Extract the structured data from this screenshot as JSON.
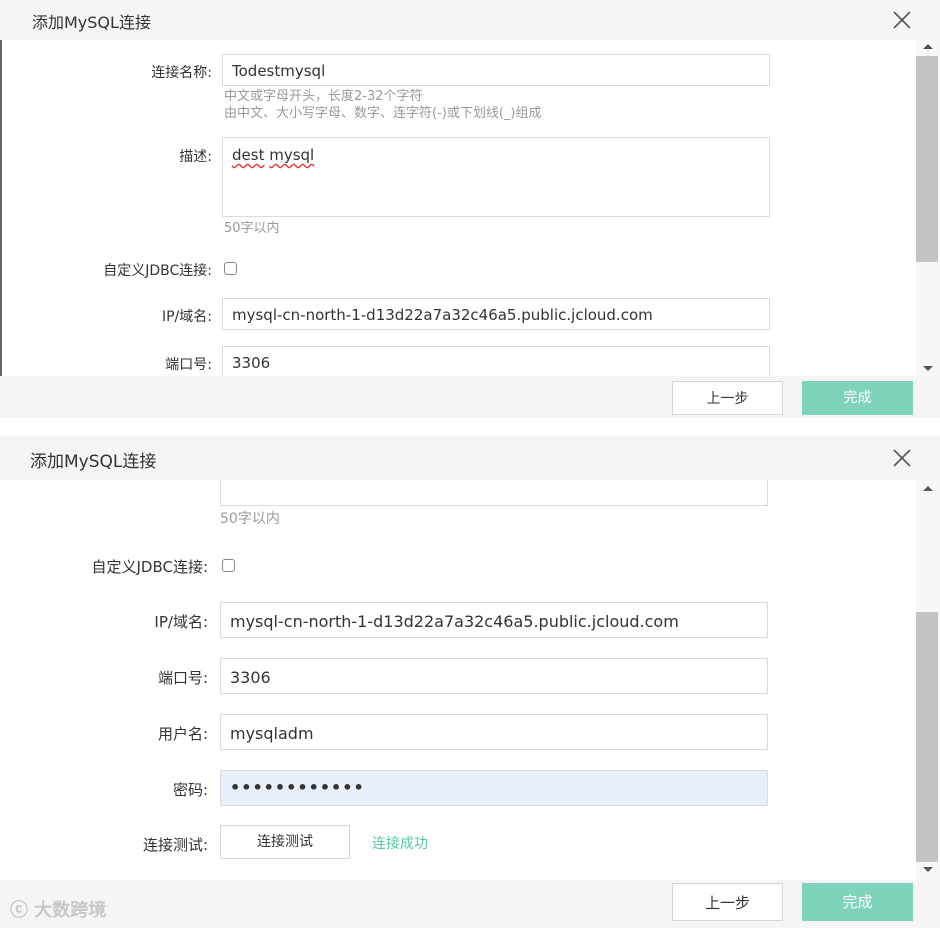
{
  "dialog": {
    "title": "添加MySQL连接"
  },
  "form": {
    "conn_name_label": "连接名称:",
    "conn_name_value": "Todestmysql",
    "conn_name_hint1": "中文或字母开头，长度2-32个字符",
    "conn_name_hint2": "由中文、大小写字母、数字、连字符(-)或下划线(_)组成",
    "desc_label": "描述:",
    "desc_word1": "dest",
    "desc_word2": "mysql",
    "desc_hint": "50字以内",
    "jdbc_label": "自定义JDBC连接:",
    "ip_label": "IP/域名:",
    "ip_value": "mysql-cn-north-1-d13d22a7a32c46a5.public.jcloud.com",
    "port_label": "端口号:",
    "port_value": "3306",
    "user_label": "用户名:",
    "user_value": "mysqladm",
    "password_label": "密码:",
    "password_value": "••••••••••••",
    "test_label": "连接测试:",
    "test_button": "连接测试",
    "test_result": "连接成功"
  },
  "footer": {
    "prev_label": "上一步",
    "done_label": "完成"
  },
  "watermark": "大数跨境",
  "colors": {
    "accent": "#7fd3bd",
    "success": "#58c8a6",
    "password_bg": "#e8f0fe"
  }
}
